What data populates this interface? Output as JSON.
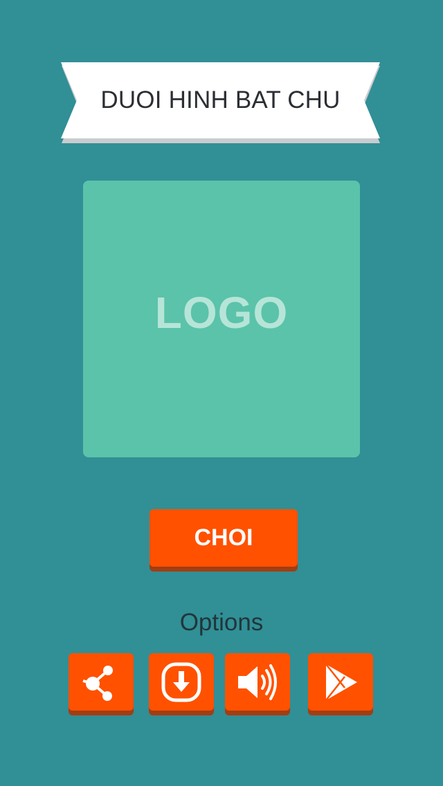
{
  "colors": {
    "background": "#318f96",
    "accent": "#ff5100",
    "logo_tile": "#5bc3aa"
  },
  "banner": {
    "title": "DUOI HINH BAT CHU"
  },
  "logo": {
    "text": "LOGO"
  },
  "play_button": {
    "label": "CHOI"
  },
  "options": {
    "label": "Options",
    "buttons": [
      {
        "icon": "share-icon"
      },
      {
        "icon": "download-icon"
      },
      {
        "icon": "sound-icon"
      },
      {
        "icon": "google-play-icon"
      }
    ]
  }
}
